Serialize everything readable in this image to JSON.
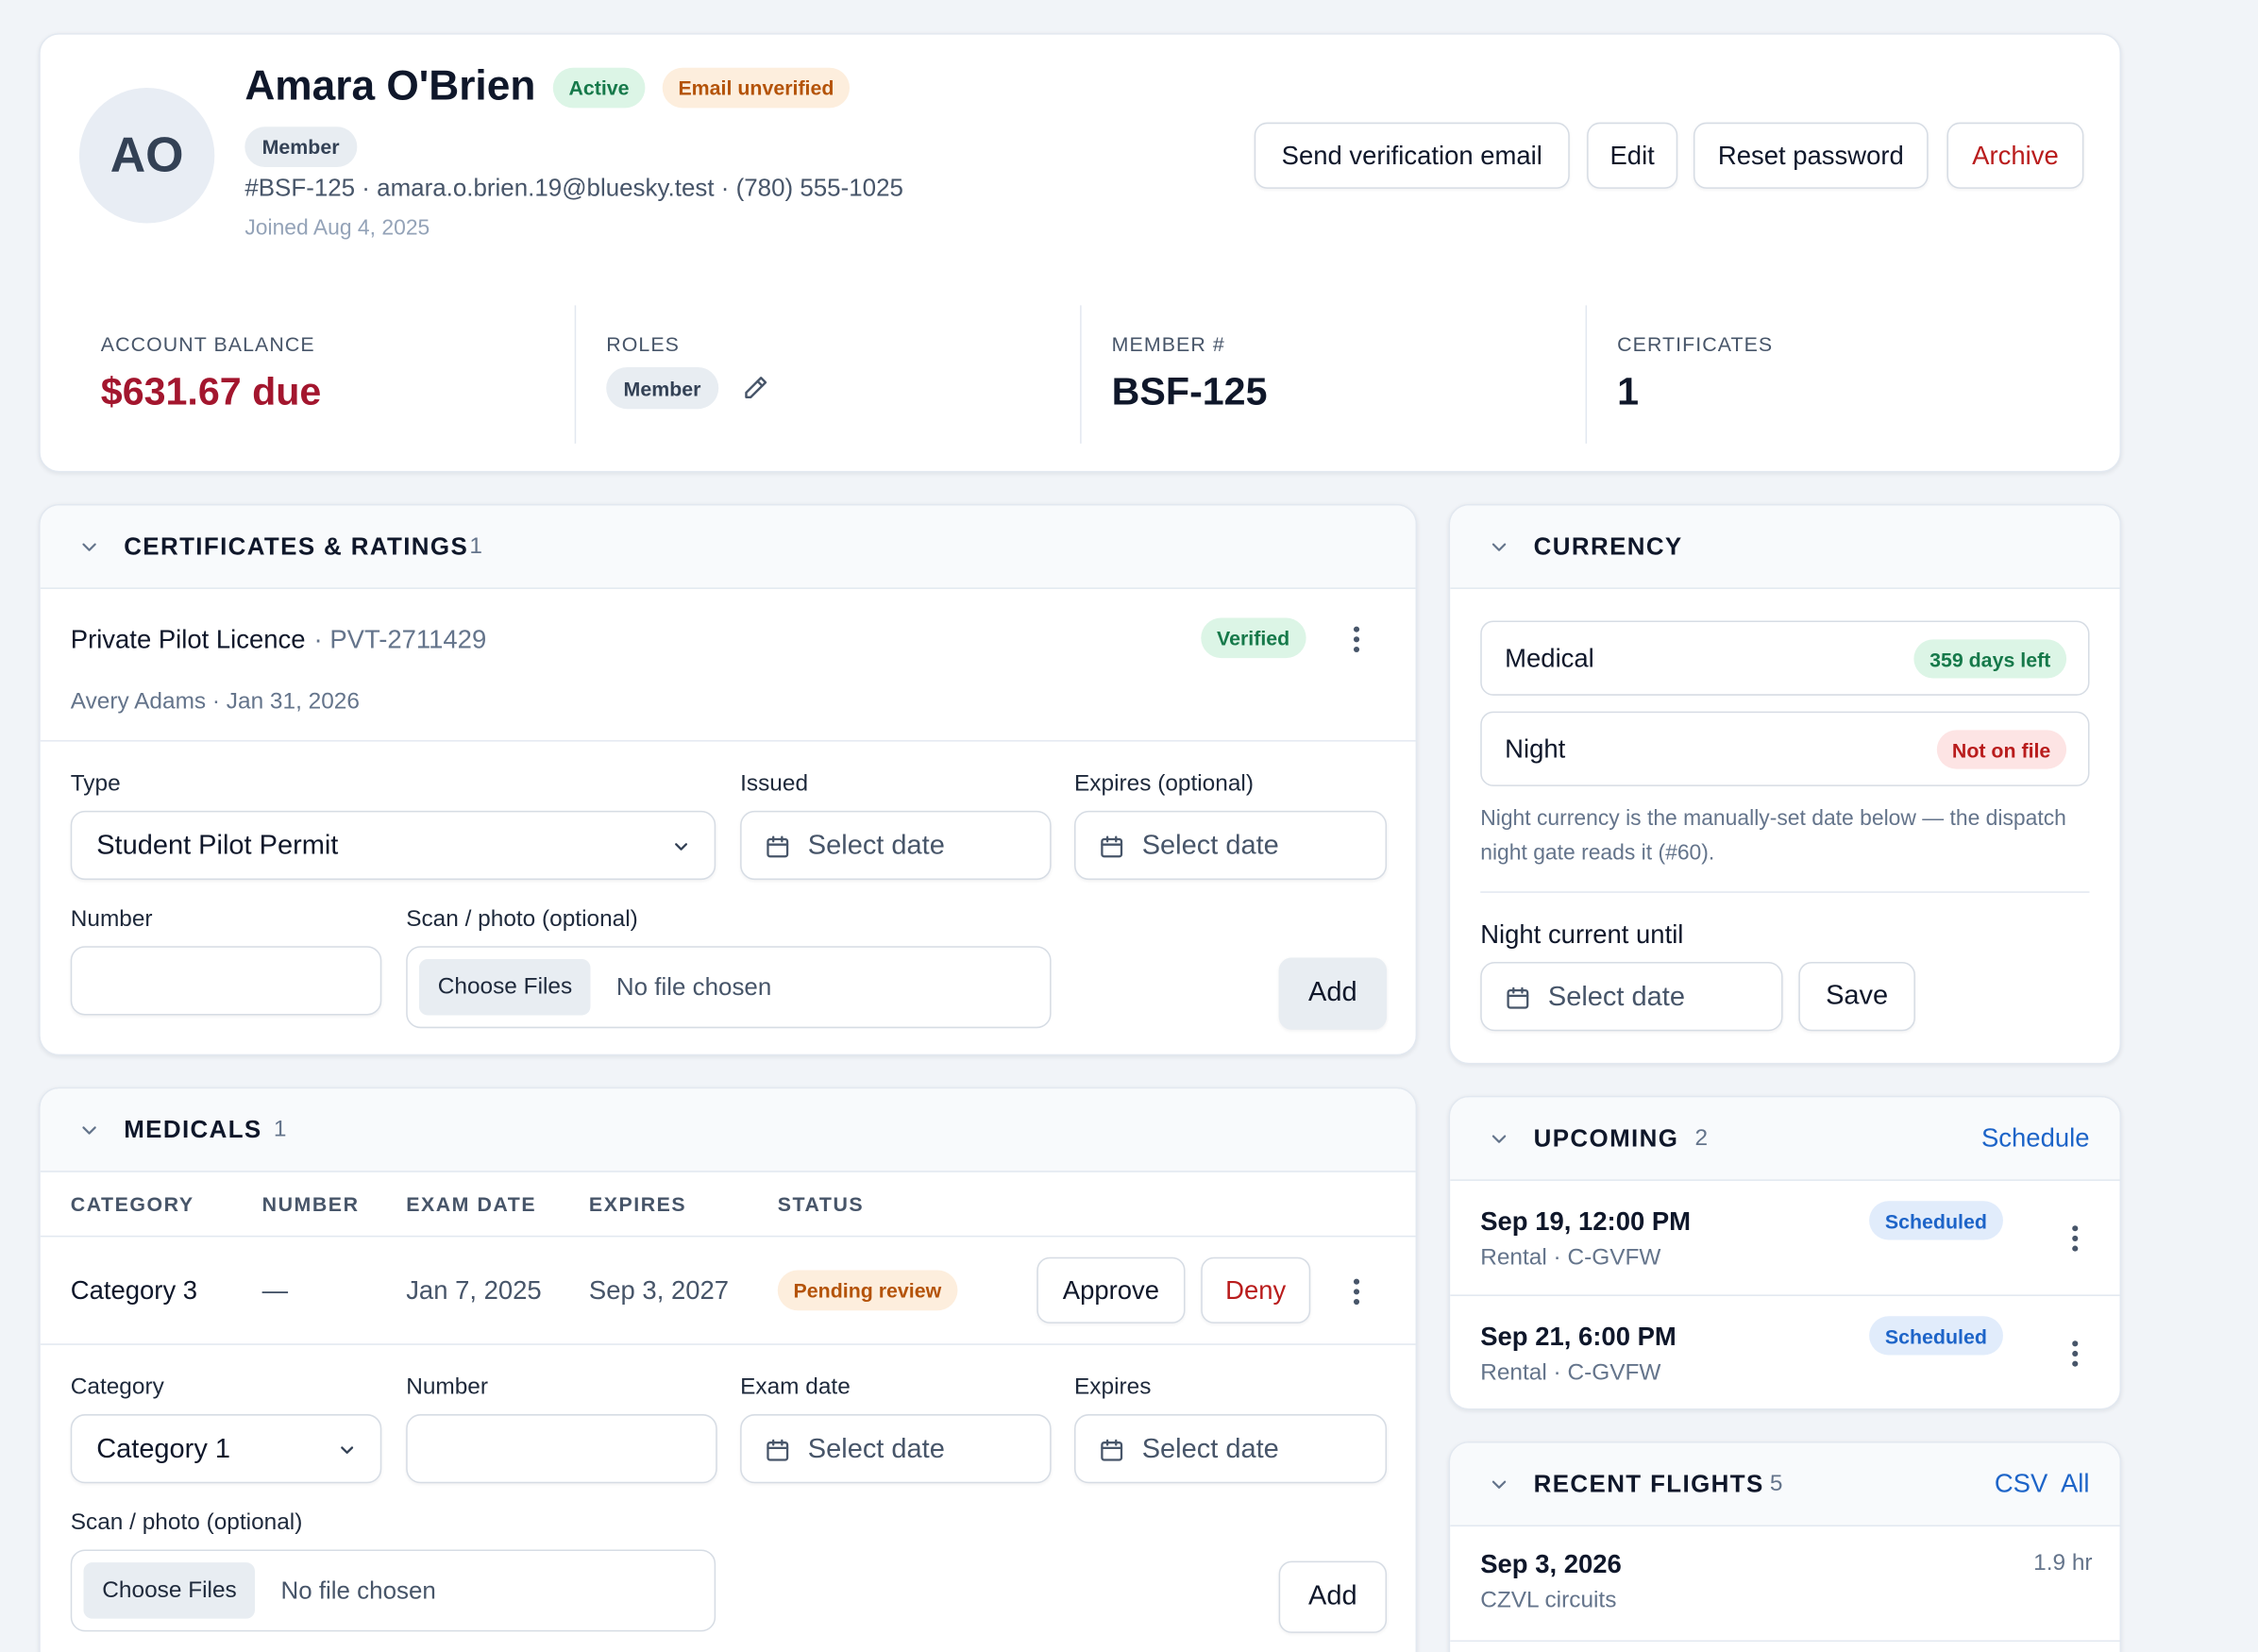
{
  "profile": {
    "initials": "AO",
    "name": "Amara O'Brien",
    "status_badge": "Active",
    "email_badge": "Email unverified",
    "role_chip": "Member",
    "meta_line": "#BSF-125 · amara.o.brien.19@bluesky.test · (780) 555-1025",
    "joined": "Joined Aug 4, 2025",
    "actions": {
      "send_verification": "Send verification email",
      "edit": "Edit",
      "reset_password": "Reset password",
      "archive": "Archive"
    }
  },
  "stats": {
    "balance_label": "ACCOUNT BALANCE",
    "balance_value": "$631.67 due",
    "roles_label": "ROLES",
    "roles_chip": "Member",
    "member_label": "MEMBER #",
    "member_value": "BSF-125",
    "certs_label": "CERTIFICATES",
    "certs_value": "1"
  },
  "certificates": {
    "title": "CERTIFICATES & RATINGS",
    "count": "1",
    "item": {
      "name": "Private Pilot Licence",
      "number": "· PVT-2711429",
      "badge": "Verified",
      "subline": "Avery Adams · Jan 31, 2026"
    },
    "form": {
      "type_label": "Type",
      "type_value": "Student Pilot Permit",
      "issued_label": "Issued",
      "issued_placeholder": "Select date",
      "expires_label": "Expires (optional)",
      "expires_placeholder": "Select date",
      "number_label": "Number",
      "scan_label": "Scan / photo (optional)",
      "choose_files": "Choose Files",
      "no_file": "No file chosen",
      "add": "Add"
    }
  },
  "medicals": {
    "title": "MEDICALS",
    "count": "1",
    "columns": [
      "CATEGORY",
      "NUMBER",
      "EXAM DATE",
      "EXPIRES",
      "STATUS"
    ],
    "row": {
      "category": "Category 3",
      "number": "—",
      "exam_date": "Jan 7, 2025",
      "expires": "Sep 3, 2027",
      "status": "Pending review",
      "approve": "Approve",
      "deny": "Deny"
    },
    "form": {
      "category_label": "Category",
      "category_value": "Category 1",
      "number_label": "Number",
      "exam_label": "Exam date",
      "exam_placeholder": "Select date",
      "expires_label": "Expires",
      "expires_placeholder": "Select date",
      "scan_label": "Scan / photo (optional)",
      "choose_files": "Choose Files",
      "no_file": "No file chosen",
      "add": "Add"
    }
  },
  "currency": {
    "title": "CURRENCY",
    "medical_label": "Medical",
    "medical_badge": "359 days left",
    "night_label": "Night",
    "night_badge": "Not on file",
    "note": "Night currency is the manually-set date below — the dispatch night gate reads it (#60).",
    "night_until_label": "Night current until",
    "night_until_placeholder": "Select date",
    "save": "Save"
  },
  "upcoming": {
    "title": "UPCOMING",
    "count": "2",
    "link": "Schedule",
    "items": [
      {
        "when": "Sep 19, 12:00 PM",
        "detail": "Rental · C-GVFW",
        "badge": "Scheduled"
      },
      {
        "when": "Sep 21, 6:00 PM",
        "detail": "Rental · C-GVFW",
        "badge": "Scheduled"
      }
    ]
  },
  "recent_flights": {
    "title": "RECENT FLIGHTS",
    "count": "5",
    "csv": "CSV",
    "all": "All",
    "items": [
      {
        "date": "Sep 3, 2026",
        "detail": "CZVL circuits",
        "hours": "1.9 hr"
      }
    ]
  },
  "colors": {
    "accent": "#1d64c8",
    "danger": "#b91c1c",
    "balance": "#a3162e",
    "success_bg": "#dcf5e6",
    "success_text": "#16794a",
    "warning_bg": "#fdeedd",
    "warning_text": "#b45309",
    "info_bg": "#e1ecfb"
  },
  "icons": [
    "chevron-down-icon",
    "calendar-icon",
    "pencil-icon",
    "kebab-menu-icon"
  ]
}
